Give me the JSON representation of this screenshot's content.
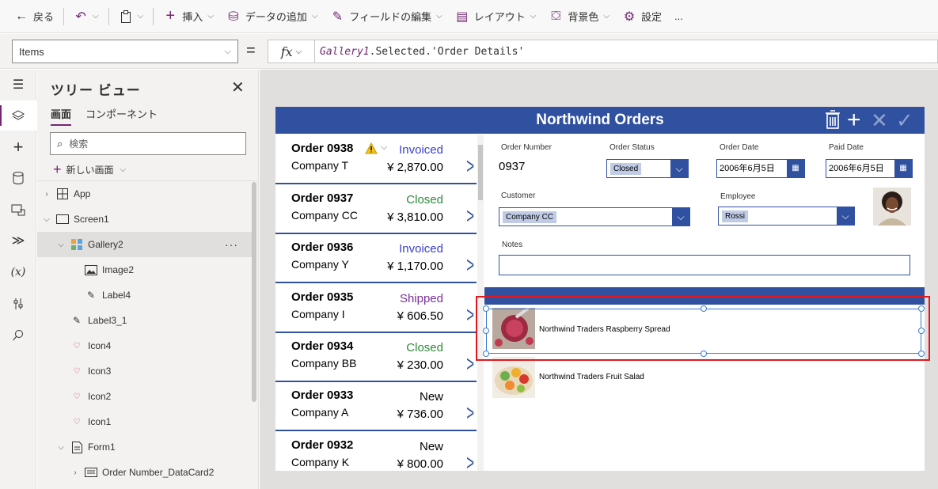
{
  "toolbar": {
    "back": "戻る",
    "insert": "挿入",
    "add_data": "データの追加",
    "edit_fields": "フィールドの編集",
    "layout": "レイアウト",
    "background": "背景色",
    "settings": "設定",
    "more": "..."
  },
  "formula_bar": {
    "property": "Items",
    "equals": "=",
    "fx": "fx",
    "formula_control": "Gallery1",
    "formula_rest": ".Selected.'Order Details'"
  },
  "tree": {
    "title": "ツリー ビュー",
    "tabs": [
      "画面",
      "コンポーネント"
    ],
    "search_placeholder": "検索",
    "new_screen": "新しい画面",
    "nodes": [
      "App",
      "Screen1",
      "Gallery2",
      "Image2",
      "Label4",
      "Label3_1",
      "Icon4",
      "Icon3",
      "Icon2",
      "Icon1",
      "Form1",
      "Order Number_DataCard2"
    ],
    "more": "···"
  },
  "app": {
    "title": "Northwind Orders",
    "orders": [
      {
        "order": "Order 0938",
        "company": "Company T",
        "status": "Invoiced",
        "total": "¥ 2,870.00",
        "status_color": "#3a40c8"
      },
      {
        "order": "Order 0937",
        "company": "Company CC",
        "status": "Closed",
        "total": "¥ 3,810.00",
        "status_color": "#2e8b3a"
      },
      {
        "order": "Order 0936",
        "company": "Company Y",
        "status": "Invoiced",
        "total": "¥ 1,170.00",
        "status_color": "#3a40c8"
      },
      {
        "order": "Order 0935",
        "company": "Company I",
        "status": "Shipped",
        "total": "¥ 606.50",
        "status_color": "#7a2f9a"
      },
      {
        "order": "Order 0934",
        "company": "Company BB",
        "status": "Closed",
        "total": "¥ 230.00",
        "status_color": "#2e8b3a"
      },
      {
        "order": "Order 0933",
        "company": "Company A",
        "status": "New",
        "total": "¥ 736.00",
        "status_color": "#000000"
      },
      {
        "order": "Order 0932",
        "company": "Company K",
        "status": "New",
        "total": "¥ 800.00",
        "status_color": "#000000"
      }
    ],
    "form": {
      "order_number_label": "Order Number",
      "order_number": "0937",
      "order_status_label": "Order Status",
      "order_status": "Closed",
      "order_date_label": "Order Date",
      "order_date": "2006年6月5日",
      "paid_date_label": "Paid Date",
      "paid_date": "2006年6月5日",
      "customer_label": "Customer",
      "customer": "Company CC",
      "employee_label": "Employee",
      "employee": "Rossi",
      "notes_label": "Notes",
      "notes": ""
    },
    "products": [
      "Northwind Traders Raspberry Spread",
      "Northwind Traders Fruit Salad"
    ]
  },
  "colors": {
    "brand": "#742774",
    "app_header": "#3050a0",
    "selection": "#3a7bd5",
    "highlight": "#e0191f"
  }
}
